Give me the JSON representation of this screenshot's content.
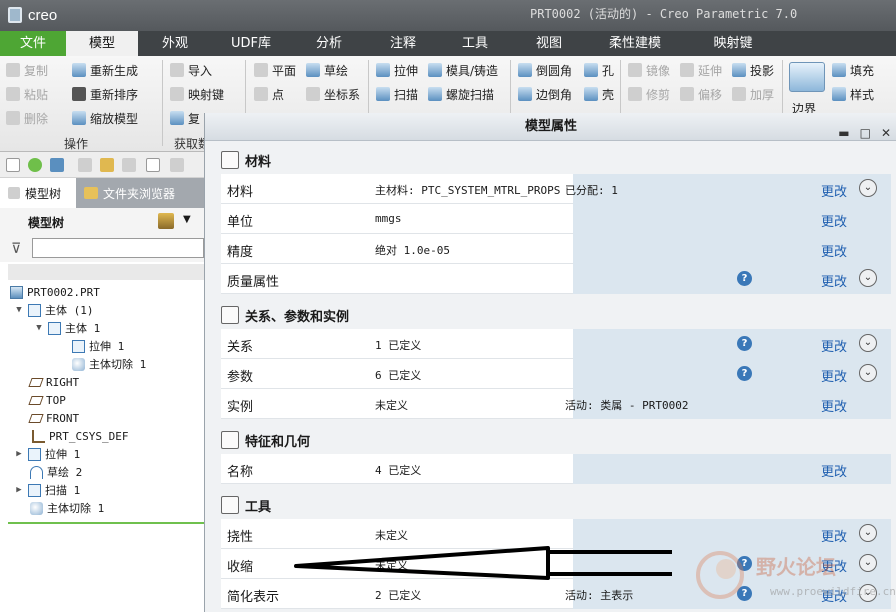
{
  "app": {
    "brand": "creo",
    "window_title": "PRT0002 (活动的) - Creo Parametric 7.0"
  },
  "menu": {
    "tabs": [
      {
        "label": "文件"
      },
      {
        "label": "模型"
      },
      {
        "label": "外观"
      },
      {
        "label": "UDF库"
      },
      {
        "label": "分析"
      },
      {
        "label": "注释"
      },
      {
        "label": "工具"
      },
      {
        "label": "视图"
      },
      {
        "label": "柔性建模"
      },
      {
        "label": "映射键"
      }
    ]
  },
  "ribbon": {
    "ops": {
      "copy": "复制",
      "paste": "粘贴",
      "delete": "删除",
      "regenerate": "重新生成",
      "reorder": "重新排序",
      "scale_model": "缩放模型",
      "group_label": "操作"
    },
    "data": {
      "import": "导入",
      "mapkey": "映射键",
      "copy_geom": "复",
      "group_label": "获取数"
    },
    "datum": {
      "plane": "平面",
      "sketch": "草绘",
      "point": "点",
      "csys": "坐标系"
    },
    "shapes": {
      "extrude": "拉伸",
      "sweep": "扫描",
      "mold_cast": "模具/铸造",
      "helical_sweep": "螺旋扫描"
    },
    "engineering": {
      "round": "倒圆角",
      "hole": "孔",
      "chamfer": "边倒角",
      "shell": "壳"
    },
    "editing": {
      "mirror": "镜像",
      "extend": "延伸",
      "project": "投影",
      "trim": "修剪",
      "offset": "偏移",
      "thicken": "加厚"
    },
    "surfaces": {
      "boundary": "边界",
      "fill": "填充",
      "style": "样式"
    }
  },
  "left_panel": {
    "tabs": {
      "model_tree": "模型树",
      "folder_browser": "文件夹浏览器"
    },
    "tree_header": "模型树",
    "tree": [
      {
        "label": "PRT0002.PRT"
      },
      {
        "label": "主体 (1)"
      },
      {
        "label": "主体 1"
      },
      {
        "label": "拉伸 1"
      },
      {
        "label": "主体切除 1"
      },
      {
        "label": "RIGHT"
      },
      {
        "label": "TOP"
      },
      {
        "label": "FRONT"
      },
      {
        "label": "PRT_CSYS_DEF"
      },
      {
        "label": "拉伸 1"
      },
      {
        "label": "草绘 2"
      },
      {
        "label": "扫描 1"
      },
      {
        "label": "主体切除 1"
      }
    ]
  },
  "dialog": {
    "title": "模型属性",
    "change_label": "更改",
    "sections": {
      "material": "材料",
      "relations": "关系、参数和实例",
      "features": "特征和几何",
      "tools": "工具"
    },
    "rows": {
      "material": {
        "label": "材料",
        "value": "主材料: PTC_SYSTEM_MTRL_PROPS",
        "extra": "已分配: 1"
      },
      "units": {
        "label": "单位",
        "value": "mmgs"
      },
      "accuracy": {
        "label": "精度",
        "value": "绝对 1.0e-05"
      },
      "mass": {
        "label": "质量属性",
        "value": ""
      },
      "relations": {
        "label": "关系",
        "value": "1 已定义"
      },
      "parameters": {
        "label": "参数",
        "value": "6 已定义"
      },
      "instances": {
        "label": "实例",
        "value": "未定义",
        "extra": "活动: 类属 - PRT0002"
      },
      "names": {
        "label": "名称",
        "value": "4 已定义"
      },
      "flexibility": {
        "label": "挠性",
        "value": "未定义"
      },
      "shrinkage": {
        "label": "收缩",
        "value": "未定义"
      },
      "simplified": {
        "label": "简化表示",
        "value": "2 已定义",
        "extra": "活动: 主表示"
      }
    }
  },
  "watermark": {
    "site": "野火论坛",
    "url": "www.proewildfire.cn"
  },
  "colors": {
    "file_tab": "#4ea634",
    "link": "#1f5fb0",
    "menubar": "#3f4346",
    "row_shade": "#dbe6ef"
  }
}
